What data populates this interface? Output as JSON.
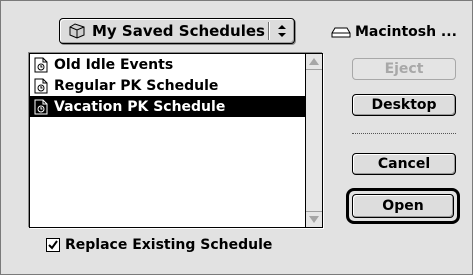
{
  "folder_popup": {
    "label": "My Saved Schedules",
    "icon": "folder-icon"
  },
  "volume": {
    "label": "Macintosh ...",
    "icon": "hard-disk-icon"
  },
  "file_list": {
    "items": [
      {
        "label": "Old Idle Events",
        "icon": "document-icon",
        "selected": false
      },
      {
        "label": "Regular PK Schedule",
        "icon": "document-icon",
        "selected": false
      },
      {
        "label": "Vacation PK Schedule",
        "icon": "document-icon",
        "selected": true
      }
    ]
  },
  "buttons": {
    "eject": {
      "label": "Eject",
      "enabled": false
    },
    "desktop": {
      "label": "Desktop",
      "enabled": true
    },
    "cancel": {
      "label": "Cancel",
      "enabled": true
    },
    "open": {
      "label": "Open",
      "enabled": true,
      "default": true
    }
  },
  "options": {
    "replace_existing": {
      "label": "Replace Existing Schedule",
      "checked": true
    }
  },
  "colors": {
    "selection": "#000000",
    "window_bg": "#e2e2e2",
    "disabled_text": "#a8a8a8"
  }
}
